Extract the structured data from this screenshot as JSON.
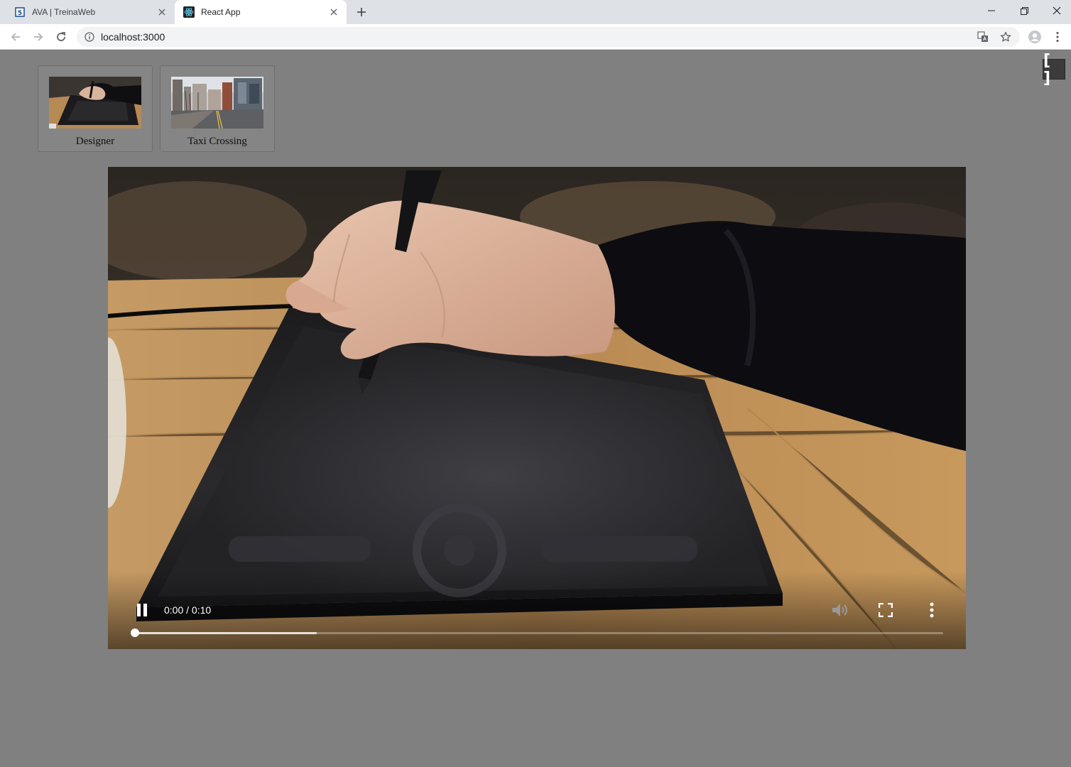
{
  "browser": {
    "tabs": [
      {
        "title": "AVA | TreinaWeb",
        "active": false,
        "favicon": "treinaweb-icon"
      },
      {
        "title": "React App",
        "active": true,
        "favicon": "react-icon"
      }
    ],
    "url": "localhost:3000"
  },
  "page": {
    "fullscreen_toggle_label": "[ ]",
    "videos": [
      {
        "title": "Designer"
      },
      {
        "title": "Taxi Crossing"
      }
    ],
    "player": {
      "time_display": "0:00 / 0:10",
      "played_fraction": 0.0,
      "buffered_fraction": 0.225,
      "state": "playing"
    }
  },
  "colors": {
    "page_background": "#808080",
    "tabstrip": "#dee1e6",
    "toolbar": "#ffffff"
  }
}
